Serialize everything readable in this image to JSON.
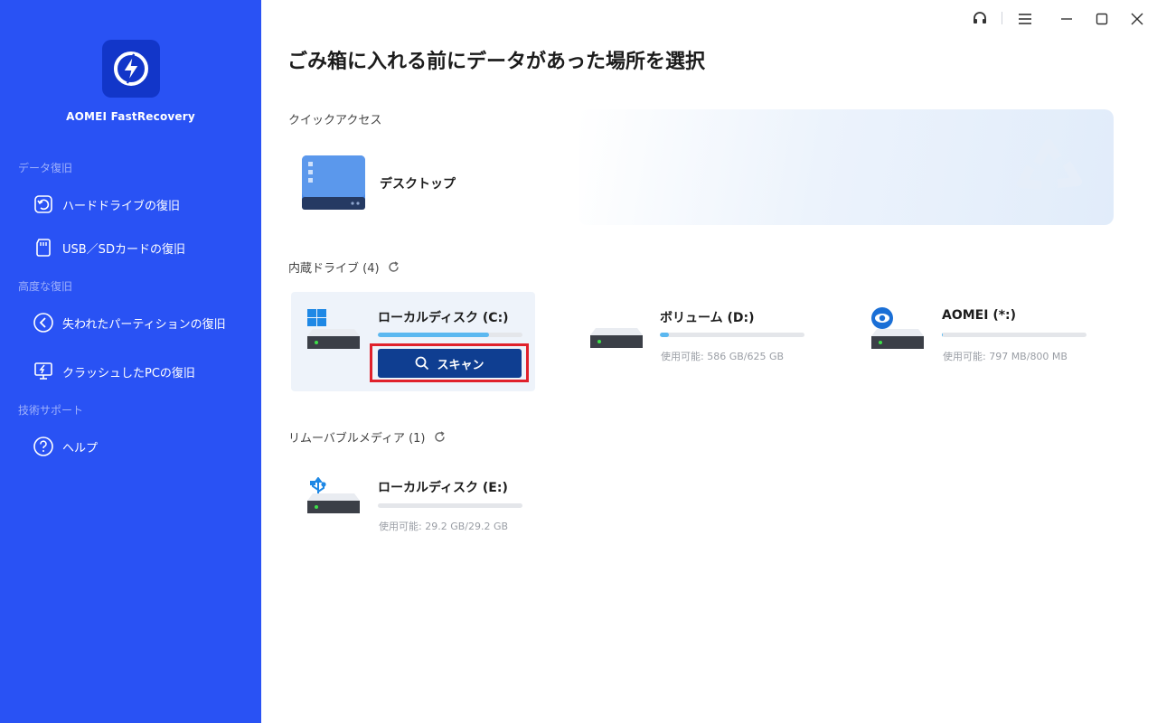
{
  "app": {
    "name": "AOMEI FastRecovery"
  },
  "sidebar": {
    "sections": [
      {
        "label": "データ復旧"
      },
      {
        "label": "高度な復旧"
      },
      {
        "label": "技術サポート"
      }
    ],
    "items": [
      {
        "label": "ハードドライブの復旧",
        "icon": "hard-drive-recovery-icon"
      },
      {
        "label": "USB／SDカードの復旧",
        "icon": "sd-card-icon"
      },
      {
        "label": "失われたパーティションの復旧",
        "icon": "partition-recovery-icon"
      },
      {
        "label": "クラッシュしたPCの復旧",
        "icon": "crashed-pc-icon"
      },
      {
        "label": "ヘルプ",
        "icon": "help-icon"
      }
    ]
  },
  "main": {
    "title": "ごみ箱に入れる前にデータがあった場所を選択",
    "quick_access": {
      "label": "クイックアクセス",
      "items": [
        {
          "label": "デスクトップ"
        }
      ]
    },
    "internal_drives": {
      "label": "内蔵ドライブ (4)",
      "drives": [
        {
          "name": "ローカルディスク (C:)",
          "used_fraction": 0.77,
          "available": "",
          "scan_label": "スキャン",
          "badge": "windows-logo-icon"
        },
        {
          "name": "ボリューム (D:)",
          "used_fraction": 0.06,
          "available": "使用可能: 586 GB/625 GB",
          "badge": ""
        },
        {
          "name": "AOMEI (*:)",
          "used_fraction": 0.004,
          "available": "使用可能: 797 MB/800 MB",
          "badge": "aomei-eye-icon"
        }
      ]
    },
    "removable": {
      "label": "リムーバブルメディア (1)",
      "drives": [
        {
          "name": "ローカルディスク (E:)",
          "used_fraction": 0.0,
          "available": "使用可能: 29.2 GB/29.2 GB",
          "badge": "usb-icon"
        }
      ]
    }
  },
  "colors": {
    "sidebar_bg": "#2952f4",
    "accent_button": "#0f3e91",
    "highlight": "#e0212b",
    "bar_fill": "#5bb8f0"
  }
}
